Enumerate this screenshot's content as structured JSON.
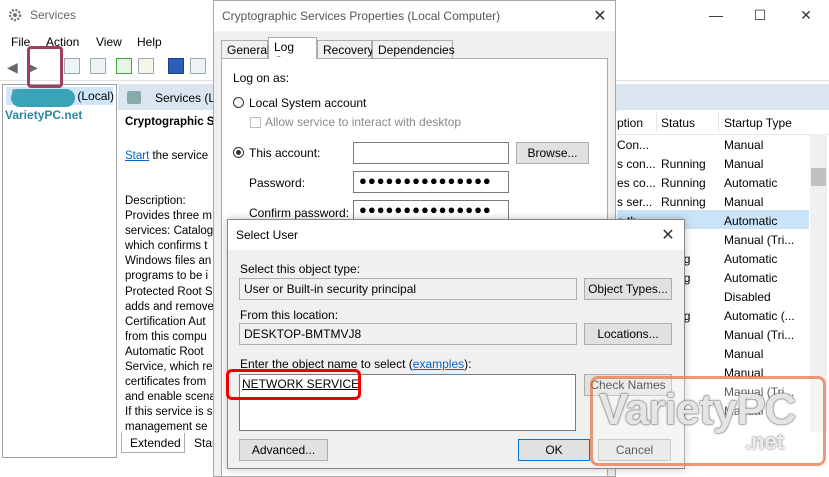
{
  "services_window": {
    "title": "Services",
    "menu": [
      "File",
      "Action",
      "View",
      "Help"
    ],
    "tree_item": "Services (Local)",
    "right_header": "Services (Lo",
    "desc_title": "Cryptographic S",
    "start_link": "Start",
    "start_rest": " the service",
    "description_label": "Description:",
    "description_lines": [
      "Provides three m",
      "services: Catalog",
      "which confirms t",
      "Windows files an",
      "programs to be i",
      "Protected Root S",
      "adds and remove",
      "Certification Aut",
      "from this compu",
      "Automatic Root",
      "Service, which re",
      "certificates from",
      "and enable scena",
      "If this service is s",
      "management se"
    ],
    "bottom_tabs": [
      "Extended",
      "Star"
    ],
    "columns": [
      "ption",
      "Status",
      "Startup Type"
    ],
    "rows": [
      {
        "desc": "Con...",
        "status": "",
        "startup": "Manual"
      },
      {
        "desc": "s con...",
        "status": "Running",
        "startup": "Manual"
      },
      {
        "desc": "es co...",
        "status": "Running",
        "startup": "Automatic"
      },
      {
        "desc": "s ser...",
        "status": "Running",
        "startup": "Manual"
      },
      {
        "desc": "e th...",
        "status": "",
        "startup": "Automatic"
      },
      {
        "desc": "",
        "status": "",
        "startup": "Manual (Tri..."
      },
      {
        "desc": "",
        "status": "nning",
        "startup": "Automatic"
      },
      {
        "desc": "",
        "status": "nning",
        "startup": "Automatic"
      },
      {
        "desc": "",
        "status": "",
        "startup": "Disabled"
      },
      {
        "desc": "",
        "status": "nning",
        "startup": "Automatic (..."
      },
      {
        "desc": "",
        "status": "",
        "startup": "Manual (Tri..."
      },
      {
        "desc": "",
        "status": "",
        "startup": "Manual"
      },
      {
        "desc": "",
        "status": "",
        "startup": "Manual"
      },
      {
        "desc": "",
        "status": "",
        "startup": "Manual (Tri..."
      },
      {
        "desc": "",
        "status": "",
        "startup": "Manual"
      }
    ]
  },
  "properties": {
    "title": "Cryptographic Services Properties (Local Computer)",
    "tabs": [
      "General",
      "Log On",
      "Recovery",
      "Dependencies"
    ],
    "logon_as": "Log on as:",
    "local_system": "Local System account",
    "allow_interact": "Allow service to interact with desktop",
    "this_account": "This account:",
    "account_value": "",
    "browse": "Browse...",
    "password_label": "Password:",
    "password_value": "●●●●●●●●●●●●●●●",
    "confirm_label": "Confirm password:",
    "confirm_value": "●●●●●●●●●●●●●●●"
  },
  "select_user": {
    "title": "Select User",
    "object_type_label": "Select this object type:",
    "object_type_value": "User or Built-in security principal",
    "object_types_button": "Object Types...",
    "location_label": "From this location:",
    "location_value": "DESKTOP-BMTMVJ8",
    "locations_button": "Locations...",
    "enter_name_label": "Enter the object name to select (",
    "examples_link": "examples",
    "enter_name_suffix": "):",
    "object_name": "NETWORK SERVICE",
    "check_names_button": "Check Names",
    "advanced_button": "Advanced...",
    "ok_button": "OK",
    "cancel_button": "Cancel"
  },
  "watermark": {
    "small": "VarietyPC.net",
    "big_main": "VarietyPC",
    "big_sub": ".net"
  },
  "colors": {
    "accent": "#0078d7",
    "highlight": "#e00000",
    "selection": "#cce4f7"
  }
}
